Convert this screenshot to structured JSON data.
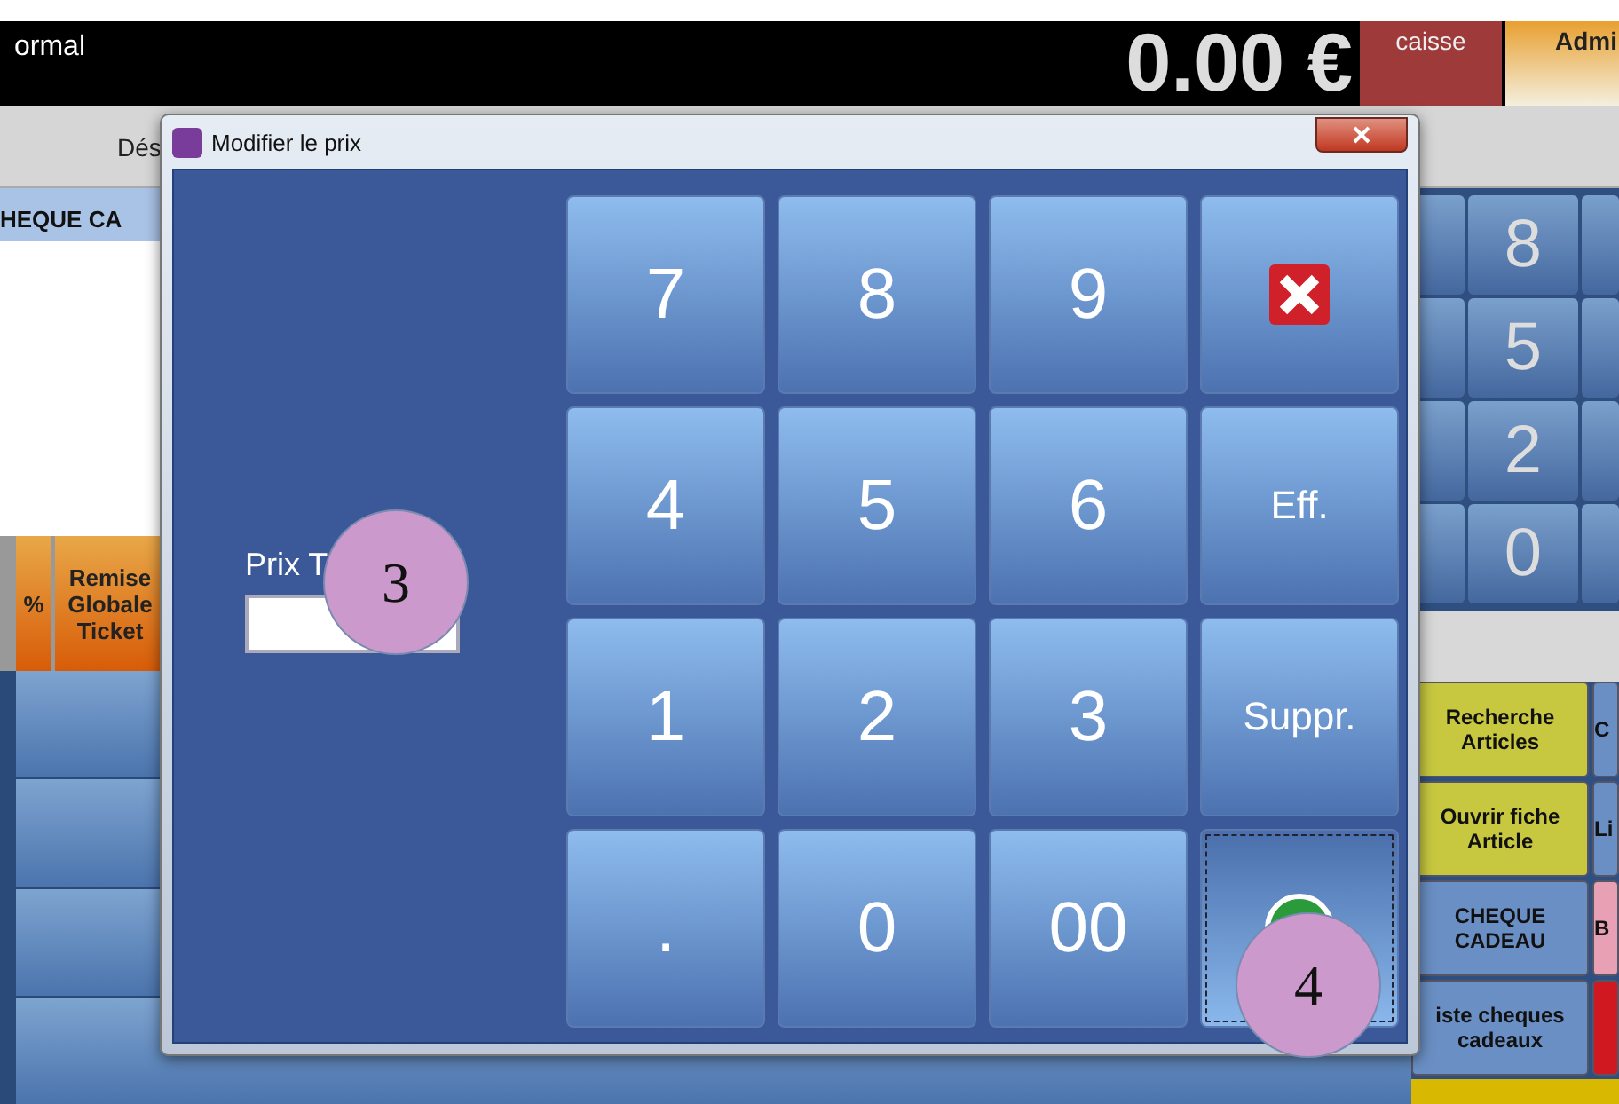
{
  "top_bar": {
    "mode": "ormal",
    "total": "0.00 €",
    "caisse": "caisse",
    "user": "Admi"
  },
  "ticket_header": {
    "column_1": "Dés"
  },
  "ticket_row": "HEQUE CA",
  "function_headers": [
    {
      "label": "%"
    },
    {
      "label": "Remise Globale Ticket"
    }
  ],
  "back_keypad": [
    "8",
    "5",
    "2",
    "0"
  ],
  "side_buttons": [
    {
      "label": "Recherche Articles",
      "color": "#c8c840"
    },
    {
      "label": "Ouvrir fiche Article",
      "color": "#c8c840"
    },
    {
      "label": "CHEQUE CADEAU",
      "color": "#6a8fc4"
    },
    {
      "label": "iste cheques cadeaux",
      "color": "#6a8fc4"
    }
  ],
  "side_buttons_2": [
    {
      "label": "C",
      "color": "#6a8fc4"
    },
    {
      "label": "Li",
      "color": "#6a8fc4"
    },
    {
      "label": "B",
      "color": "#e8a0b4"
    },
    {
      "color": "#d01820"
    }
  ],
  "dialog": {
    "title": "Modifier le prix",
    "field_label": "Prix T",
    "keys": [
      {
        "kind": "digit",
        "label": "7"
      },
      {
        "kind": "digit",
        "label": "8"
      },
      {
        "kind": "digit",
        "label": "9"
      },
      {
        "kind": "cancel"
      },
      {
        "kind": "digit",
        "label": "4"
      },
      {
        "kind": "digit",
        "label": "5"
      },
      {
        "kind": "digit",
        "label": "6"
      },
      {
        "kind": "text",
        "label": "Eff."
      },
      {
        "kind": "digit",
        "label": "1"
      },
      {
        "kind": "digit",
        "label": "2"
      },
      {
        "kind": "digit",
        "label": "3"
      },
      {
        "kind": "text",
        "label": "Suppr."
      },
      {
        "kind": "digit",
        "label": "."
      },
      {
        "kind": "digit",
        "label": "0"
      },
      {
        "kind": "digit",
        "label": "00"
      },
      {
        "kind": "ok",
        "focused": true
      }
    ]
  },
  "callouts": [
    {
      "label": "3"
    },
    {
      "label": "4"
    }
  ]
}
